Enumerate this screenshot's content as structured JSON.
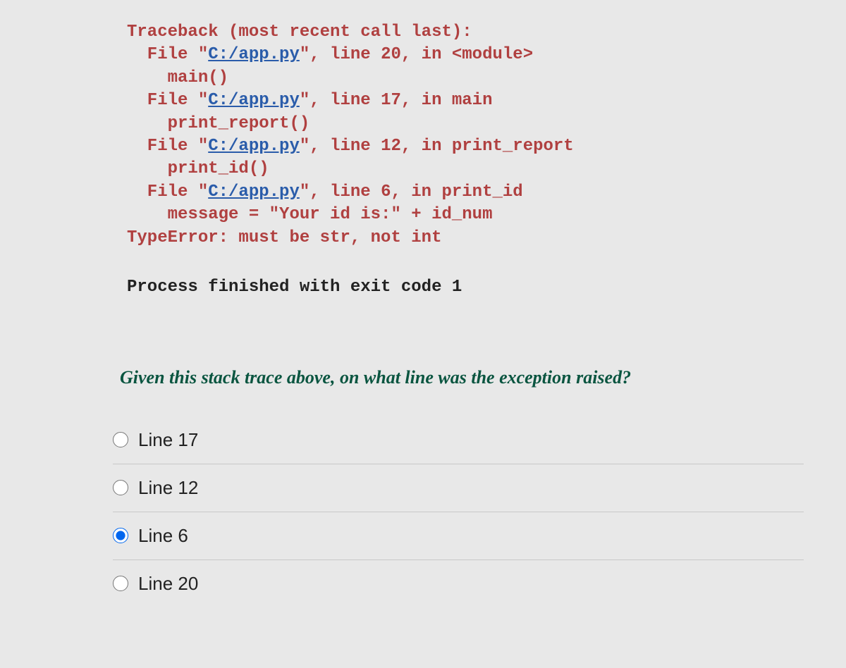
{
  "traceback": {
    "header": "Traceback (most recent call last):",
    "frames": [
      {
        "prefix": "  File \"",
        "path": "C:/app.py",
        "suffix": "\", line 20, in <module>",
        "code": "    main()"
      },
      {
        "prefix": "  File \"",
        "path": "C:/app.py",
        "suffix": "\", line 17, in main",
        "code": "    print_report()"
      },
      {
        "prefix": "  File \"",
        "path": "C:/app.py",
        "suffix": "\", line 12, in print_report",
        "code": "    print_id()"
      },
      {
        "prefix": "  File \"",
        "path": "C:/app.py",
        "suffix": "\", line 6, in print_id",
        "code": "    message = \"Your id is:\" + id_num"
      }
    ],
    "error": "TypeError: must be str, not int"
  },
  "process_text": "Process finished with exit code 1",
  "question_text": "Given this stack trace above, on what line was the exception raised?",
  "options": [
    {
      "label": "Line 17",
      "selected": false
    },
    {
      "label": "Line 12",
      "selected": false
    },
    {
      "label": "Line 6",
      "selected": true
    },
    {
      "label": "Line 20",
      "selected": false
    }
  ]
}
